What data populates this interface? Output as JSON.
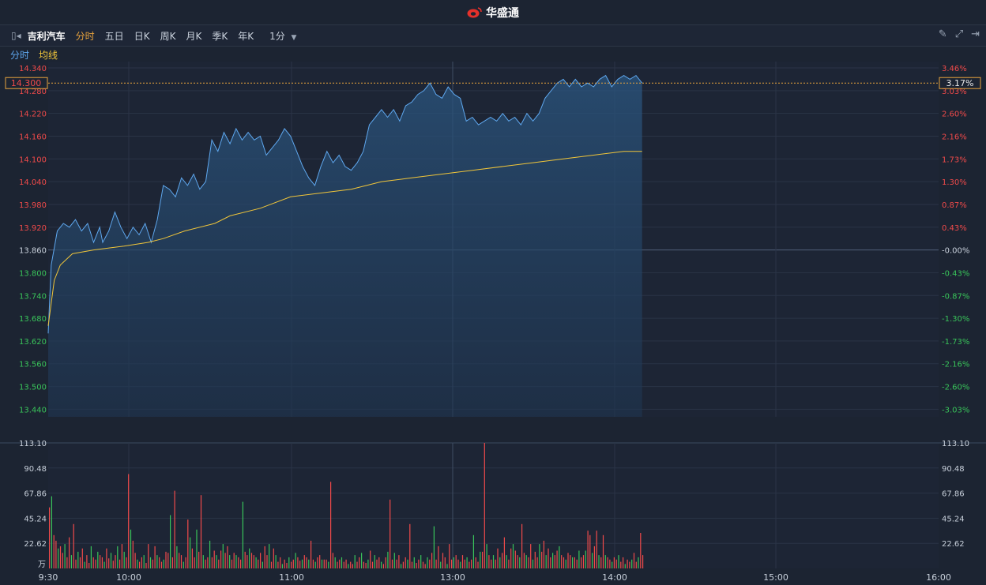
{
  "header": {
    "brand": "华盛通"
  },
  "toolbar": {
    "stock_name": "吉利汽车",
    "tabs": [
      "分时",
      "五日",
      "日K",
      "周K",
      "月K",
      "季K",
      "年K"
    ],
    "active_tab": "分时",
    "interval": "1分"
  },
  "subbar": {
    "mode": "分时",
    "avg_label": "均线"
  },
  "colors": {
    "price": "#5fa8ef",
    "avg": "#f0c53a",
    "up": "#f04a4a",
    "down": "#39c45a",
    "cursor": "#e8a33d"
  },
  "chart_data": {
    "type": "line",
    "prev_close": 13.86,
    "cursor": {
      "price": "14.300",
      "pct": "3.17%"
    },
    "price_ticks": [
      "14.340",
      "14.280",
      "14.220",
      "14.160",
      "14.100",
      "14.040",
      "13.980",
      "13.920",
      "13.860",
      "13.800",
      "13.740",
      "13.680",
      "13.620",
      "13.560",
      "13.500",
      "13.440"
    ],
    "pct_ticks": [
      "3.46%",
      "3.03%",
      "2.60%",
      "2.16%",
      "1.73%",
      "1.30%",
      "0.87%",
      "0.43%",
      "-0.00%",
      "-0.43%",
      "-0.87%",
      "-1.30%",
      "-1.73%",
      "-2.16%",
      "-2.60%",
      "-3.03%"
    ],
    "ylim": [
      13.42,
      14.34
    ],
    "volume_ticks": [
      "113.10",
      "90.48",
      "67.86",
      "45.24",
      "22.62"
    ],
    "volume_unit": "万",
    "volume_max": 113.1,
    "time_labels": [
      "9:30",
      "10:00",
      "11:00",
      "13:00",
      "14:00",
      "15:00",
      "16:00"
    ],
    "price_points": [
      [
        0,
        13.64
      ],
      [
        1,
        13.82
      ],
      [
        3,
        13.91
      ],
      [
        5,
        13.93
      ],
      [
        7,
        13.92
      ],
      [
        9,
        13.94
      ],
      [
        11,
        13.91
      ],
      [
        13,
        13.93
      ],
      [
        15,
        13.88
      ],
      [
        17,
        13.92
      ],
      [
        18,
        13.88
      ],
      [
        20,
        13.91
      ],
      [
        22,
        13.96
      ],
      [
        24,
        13.92
      ],
      [
        26,
        13.89
      ],
      [
        28,
        13.92
      ],
      [
        30,
        13.9
      ],
      [
        32,
        13.93
      ],
      [
        34,
        13.88
      ],
      [
        36,
        13.94
      ],
      [
        38,
        14.03
      ],
      [
        40,
        14.02
      ],
      [
        42,
        14.0
      ],
      [
        44,
        14.05
      ],
      [
        46,
        14.03
      ],
      [
        48,
        14.06
      ],
      [
        50,
        14.02
      ],
      [
        52,
        14.04
      ],
      [
        54,
        14.15
      ],
      [
        56,
        14.12
      ],
      [
        58,
        14.17
      ],
      [
        60,
        14.14
      ],
      [
        62,
        14.18
      ],
      [
        64,
        14.15
      ],
      [
        66,
        14.17
      ],
      [
        68,
        14.15
      ],
      [
        70,
        14.16
      ],
      [
        72,
        14.11
      ],
      [
        74,
        14.13
      ],
      [
        76,
        14.15
      ],
      [
        78,
        14.18
      ],
      [
        80,
        14.16
      ],
      [
        82,
        14.12
      ],
      [
        84,
        14.08
      ],
      [
        86,
        14.05
      ],
      [
        88,
        14.03
      ],
      [
        90,
        14.08
      ],
      [
        92,
        14.12
      ],
      [
        94,
        14.09
      ],
      [
        96,
        14.11
      ],
      [
        98,
        14.08
      ],
      [
        100,
        14.07
      ],
      [
        102,
        14.09
      ],
      [
        104,
        14.12
      ],
      [
        106,
        14.19
      ],
      [
        108,
        14.21
      ],
      [
        110,
        14.23
      ],
      [
        112,
        14.21
      ],
      [
        114,
        14.23
      ],
      [
        116,
        14.2
      ],
      [
        118,
        14.24
      ],
      [
        120,
        14.25
      ],
      [
        122,
        14.27
      ],
      [
        124,
        14.28
      ],
      [
        126,
        14.3
      ],
      [
        128,
        14.27
      ],
      [
        130,
        14.26
      ],
      [
        132,
        14.29
      ],
      [
        134,
        14.27
      ],
      [
        136,
        14.26
      ],
      [
        138,
        14.2
      ],
      [
        140,
        14.21
      ],
      [
        142,
        14.19
      ],
      [
        144,
        14.2
      ],
      [
        146,
        14.21
      ],
      [
        148,
        14.2
      ],
      [
        150,
        14.22
      ],
      [
        152,
        14.2
      ],
      [
        154,
        14.21
      ],
      [
        156,
        14.19
      ],
      [
        158,
        14.22
      ],
      [
        160,
        14.2
      ],
      [
        162,
        14.22
      ],
      [
        164,
        14.26
      ],
      [
        166,
        14.28
      ],
      [
        168,
        14.3
      ],
      [
        170,
        14.31
      ],
      [
        172,
        14.29
      ],
      [
        174,
        14.31
      ],
      [
        176,
        14.29
      ],
      [
        178,
        14.3
      ],
      [
        180,
        14.29
      ],
      [
        182,
        14.31
      ],
      [
        184,
        14.32
      ],
      [
        186,
        14.29
      ],
      [
        188,
        14.31
      ],
      [
        190,
        14.32
      ],
      [
        192,
        14.31
      ],
      [
        194,
        14.32
      ],
      [
        196,
        14.3
      ]
    ],
    "avg_points": [
      [
        0,
        13.66
      ],
      [
        2,
        13.78
      ],
      [
        4,
        13.82
      ],
      [
        8,
        13.85
      ],
      [
        15,
        13.86
      ],
      [
        25,
        13.87
      ],
      [
        33,
        13.88
      ],
      [
        38,
        13.89
      ],
      [
        45,
        13.91
      ],
      [
        55,
        13.93
      ],
      [
        60,
        13.95
      ],
      [
        70,
        13.97
      ],
      [
        80,
        14.0
      ],
      [
        90,
        14.01
      ],
      [
        100,
        14.02
      ],
      [
        110,
        14.04
      ],
      [
        120,
        14.05
      ],
      [
        130,
        14.06
      ],
      [
        140,
        14.07
      ],
      [
        150,
        14.08
      ],
      [
        160,
        14.09
      ],
      [
        170,
        14.1
      ],
      [
        180,
        14.11
      ],
      [
        190,
        14.12
      ],
      [
        196,
        14.12
      ]
    ],
    "volumes": [
      [
        0,
        55
      ],
      [
        1,
        65
      ],
      [
        2,
        30
      ],
      [
        3,
        25
      ],
      [
        4,
        18
      ],
      [
        5,
        20
      ],
      [
        6,
        14
      ],
      [
        7,
        22
      ],
      [
        8,
        10
      ],
      [
        9,
        28
      ],
      [
        10,
        12
      ],
      [
        11,
        40
      ],
      [
        12,
        8
      ],
      [
        13,
        15
      ],
      [
        14,
        10
      ],
      [
        15,
        18
      ],
      [
        16,
        6
      ],
      [
        17,
        12
      ],
      [
        18,
        5
      ],
      [
        19,
        20
      ],
      [
        20,
        10
      ],
      [
        21,
        8
      ],
      [
        22,
        15
      ],
      [
        23,
        12
      ],
      [
        24,
        10
      ],
      [
        25,
        6
      ],
      [
        26,
        18
      ],
      [
        27,
        9
      ],
      [
        28,
        14
      ],
      [
        29,
        7
      ],
      [
        30,
        12
      ],
      [
        31,
        20
      ],
      [
        32,
        8
      ],
      [
        33,
        22
      ],
      [
        34,
        15
      ],
      [
        35,
        10
      ],
      [
        36,
        85
      ],
      [
        37,
        35
      ],
      [
        38,
        25
      ],
      [
        39,
        14
      ],
      [
        40,
        8
      ],
      [
        41,
        6
      ],
      [
        42,
        10
      ],
      [
        43,
        12
      ],
      [
        44,
        5
      ],
      [
        45,
        22
      ],
      [
        46,
        10
      ],
      [
        47,
        8
      ],
      [
        48,
        20
      ],
      [
        49,
        12
      ],
      [
        50,
        10
      ],
      [
        51,
        6
      ],
      [
        52,
        8
      ],
      [
        53,
        15
      ],
      [
        54,
        14
      ],
      [
        55,
        48
      ],
      [
        56,
        10
      ],
      [
        57,
        70
      ],
      [
        58,
        20
      ],
      [
        59,
        14
      ],
      [
        60,
        12
      ],
      [
        61,
        6
      ],
      [
        62,
        10
      ],
      [
        63,
        44
      ],
      [
        64,
        28
      ],
      [
        65,
        18
      ],
      [
        66,
        10
      ],
      [
        67,
        35
      ],
      [
        68,
        15
      ],
      [
        69,
        66
      ],
      [
        70,
        12
      ],
      [
        71,
        8
      ],
      [
        72,
        10
      ],
      [
        73,
        25
      ],
      [
        74,
        10
      ],
      [
        75,
        16
      ],
      [
        76,
        12
      ],
      [
        77,
        8
      ],
      [
        78,
        16
      ],
      [
        79,
        22
      ],
      [
        80,
        14
      ],
      [
        81,
        20
      ],
      [
        82,
        12
      ],
      [
        83,
        8
      ],
      [
        84,
        14
      ],
      [
        85,
        12
      ],
      [
        86,
        10
      ],
      [
        87,
        8
      ],
      [
        88,
        60
      ],
      [
        89,
        15
      ],
      [
        90,
        12
      ],
      [
        91,
        18
      ],
      [
        92,
        14
      ],
      [
        93,
        12
      ],
      [
        94,
        10
      ],
      [
        95,
        8
      ],
      [
        96,
        14
      ],
      [
        97,
        6
      ],
      [
        98,
        20
      ],
      [
        99,
        12
      ],
      [
        100,
        22
      ],
      [
        101,
        6
      ],
      [
        102,
        18
      ],
      [
        103,
        12
      ],
      [
        104,
        6
      ],
      [
        105,
        10
      ],
      [
        106,
        4
      ],
      [
        107,
        8
      ],
      [
        108,
        5
      ],
      [
        109,
        10
      ],
      [
        110,
        6
      ],
      [
        111,
        8
      ],
      [
        112,
        14
      ],
      [
        113,
        10
      ],
      [
        114,
        7
      ],
      [
        115,
        8
      ],
      [
        116,
        12
      ],
      [
        117,
        10
      ],
      [
        118,
        8
      ],
      [
        119,
        25
      ],
      [
        120,
        8
      ],
      [
        121,
        6
      ],
      [
        122,
        10
      ],
      [
        123,
        12
      ],
      [
        124,
        8
      ],
      [
        125,
        8
      ],
      [
        126,
        8
      ],
      [
        127,
        6
      ],
      [
        128,
        78
      ],
      [
        129,
        14
      ],
      [
        130,
        10
      ],
      [
        131,
        6
      ],
      [
        132,
        8
      ],
      [
        133,
        10
      ],
      [
        134,
        6
      ],
      [
        135,
        8
      ],
      [
        136,
        4
      ],
      [
        137,
        6
      ],
      [
        138,
        4
      ],
      [
        139,
        12
      ],
      [
        140,
        6
      ],
      [
        141,
        10
      ],
      [
        142,
        14
      ],
      [
        143,
        6
      ],
      [
        144,
        5
      ],
      [
        145,
        8
      ],
      [
        146,
        16
      ],
      [
        147,
        6
      ],
      [
        148,
        12
      ],
      [
        149,
        8
      ],
      [
        150,
        10
      ],
      [
        151,
        6
      ],
      [
        152,
        4
      ],
      [
        153,
        10
      ],
      [
        154,
        15
      ],
      [
        155,
        62
      ],
      [
        156,
        8
      ],
      [
        157,
        14
      ],
      [
        158,
        8
      ],
      [
        159,
        12
      ],
      [
        160,
        4
      ],
      [
        161,
        6
      ],
      [
        162,
        10
      ],
      [
        163,
        8
      ],
      [
        164,
        40
      ],
      [
        165,
        6
      ],
      [
        166,
        10
      ],
      [
        167,
        5
      ],
      [
        168,
        8
      ],
      [
        169,
        12
      ],
      [
        170,
        6
      ],
      [
        171,
        4
      ],
      [
        172,
        10
      ],
      [
        173,
        8
      ],
      [
        174,
        14
      ],
      [
        175,
        38
      ],
      [
        176,
        8
      ],
      [
        177,
        20
      ],
      [
        178,
        6
      ],
      [
        179,
        14
      ],
      [
        180,
        10
      ],
      [
        181,
        4
      ],
      [
        182,
        22
      ],
      [
        183,
        8
      ],
      [
        184,
        10
      ],
      [
        185,
        12
      ],
      [
        186,
        8
      ],
      [
        187,
        6
      ],
      [
        188,
        12
      ],
      [
        189,
        8
      ],
      [
        190,
        10
      ],
      [
        191,
        6
      ],
      [
        192,
        8
      ],
      [
        193,
        30
      ],
      [
        194,
        10
      ],
      [
        195,
        6
      ],
      [
        196,
        15
      ],
      [
        197,
        15
      ],
      [
        198,
        113.1
      ],
      [
        199,
        22
      ],
      [
        200,
        12
      ],
      [
        201,
        8
      ],
      [
        202,
        12
      ],
      [
        203,
        8
      ],
      [
        204,
        18
      ],
      [
        205,
        10
      ],
      [
        206,
        14
      ],
      [
        207,
        28
      ],
      [
        208,
        12
      ],
      [
        209,
        8
      ],
      [
        210,
        18
      ],
      [
        211,
        22
      ],
      [
        212,
        16
      ],
      [
        213,
        12
      ],
      [
        214,
        10
      ],
      [
        215,
        40
      ],
      [
        216,
        14
      ],
      [
        217,
        12
      ],
      [
        218,
        10
      ],
      [
        219,
        22
      ],
      [
        220,
        8
      ],
      [
        221,
        15
      ],
      [
        222,
        10
      ],
      [
        223,
        22
      ],
      [
        224,
        15
      ],
      [
        225,
        25
      ],
      [
        226,
        12
      ],
      [
        227,
        18
      ],
      [
        228,
        10
      ],
      [
        229,
        14
      ],
      [
        230,
        12
      ],
      [
        231,
        16
      ],
      [
        232,
        20
      ],
      [
        233,
        12
      ],
      [
        234,
        10
      ],
      [
        235,
        8
      ],
      [
        236,
        14
      ],
      [
        237,
        12
      ],
      [
        238,
        10
      ],
      [
        239,
        10
      ],
      [
        240,
        8
      ],
      [
        241,
        16
      ],
      [
        242,
        10
      ],
      [
        243,
        12
      ],
      [
        244,
        16
      ],
      [
        245,
        34
      ],
      [
        246,
        30
      ],
      [
        247,
        14
      ],
      [
        248,
        20
      ],
      [
        249,
        34
      ],
      [
        250,
        12
      ],
      [
        251,
        10
      ],
      [
        252,
        30
      ],
      [
        253,
        12
      ],
      [
        254,
        10
      ],
      [
        255,
        8
      ],
      [
        256,
        6
      ],
      [
        257,
        10
      ],
      [
        258,
        8
      ],
      [
        259,
        12
      ],
      [
        260,
        6
      ],
      [
        261,
        10
      ],
      [
        262,
        4
      ],
      [
        263,
        8
      ],
      [
        264,
        6
      ],
      [
        265,
        8
      ],
      [
        266,
        14
      ],
      [
        267,
        6
      ],
      [
        268,
        10
      ],
      [
        269,
        32
      ],
      [
        270,
        12
      ]
    ]
  }
}
